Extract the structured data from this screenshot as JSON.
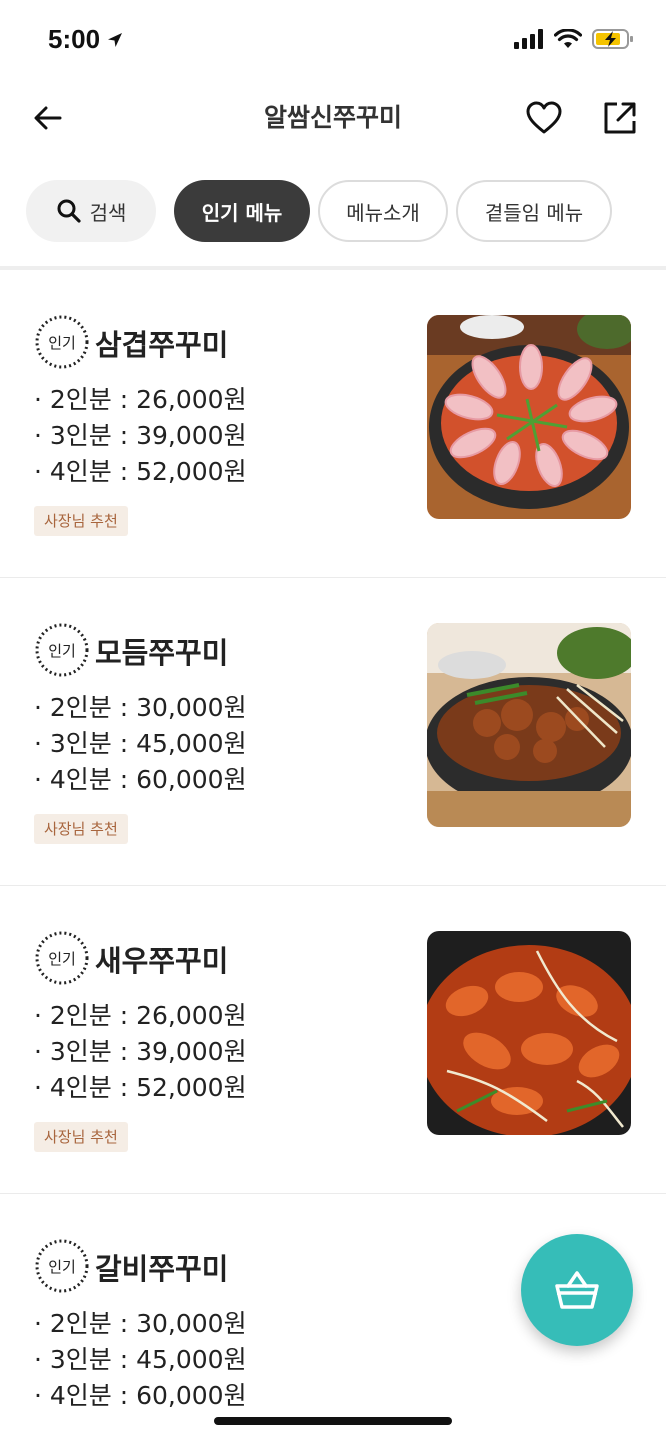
{
  "status_bar": {
    "time": "5:00",
    "icons": [
      "location-arrow-icon",
      "signal-icon",
      "wifi-icon",
      "battery-charging-icon"
    ]
  },
  "header": {
    "title": "알쌈신쭈꾸미",
    "icons": [
      "back-arrow-icon",
      "heart-icon",
      "share-icon"
    ]
  },
  "tabs": [
    {
      "label": "검색",
      "icon": "search-icon",
      "active": false
    },
    {
      "label": "인기 메뉴",
      "active": true
    },
    {
      "label": "메뉴소개",
      "active": false
    },
    {
      "label": "곁들임 메뉴",
      "active": false
    }
  ],
  "badge_text": "인기",
  "menu_items": [
    {
      "name": "삼겹쭈꾸미",
      "prices": [
        "· 2인분 : 26,000원",
        "· 3인분 : 39,000원",
        "· 4인분 : 52,000원"
      ],
      "tag": "사장님 추천"
    },
    {
      "name": "모듬쭈꾸미",
      "prices": [
        "· 2인분 : 30,000원",
        "· 3인분 : 45,000원",
        "· 4인분 : 60,000원"
      ],
      "tag": "사장님 추천"
    },
    {
      "name": "새우쭈꾸미",
      "prices": [
        "· 2인분 : 26,000원",
        "· 3인분 : 39,000원",
        "· 4인분 : 52,000원"
      ],
      "tag": "사장님 추천"
    },
    {
      "name": "갈비쭈꾸미",
      "prices": [
        "· 2인분 : 30,000원",
        "· 3인분 : 45,000원",
        "· 4인분 : 60,000원"
      ],
      "tag": ""
    }
  ],
  "cart": {
    "icon": "shopping-basket-icon",
    "color": "#36bdb8"
  },
  "colors": {
    "tab_active_bg": "#3b3b3b",
    "tag_bg": "#f5ede5",
    "tag_text": "#a8653d"
  }
}
